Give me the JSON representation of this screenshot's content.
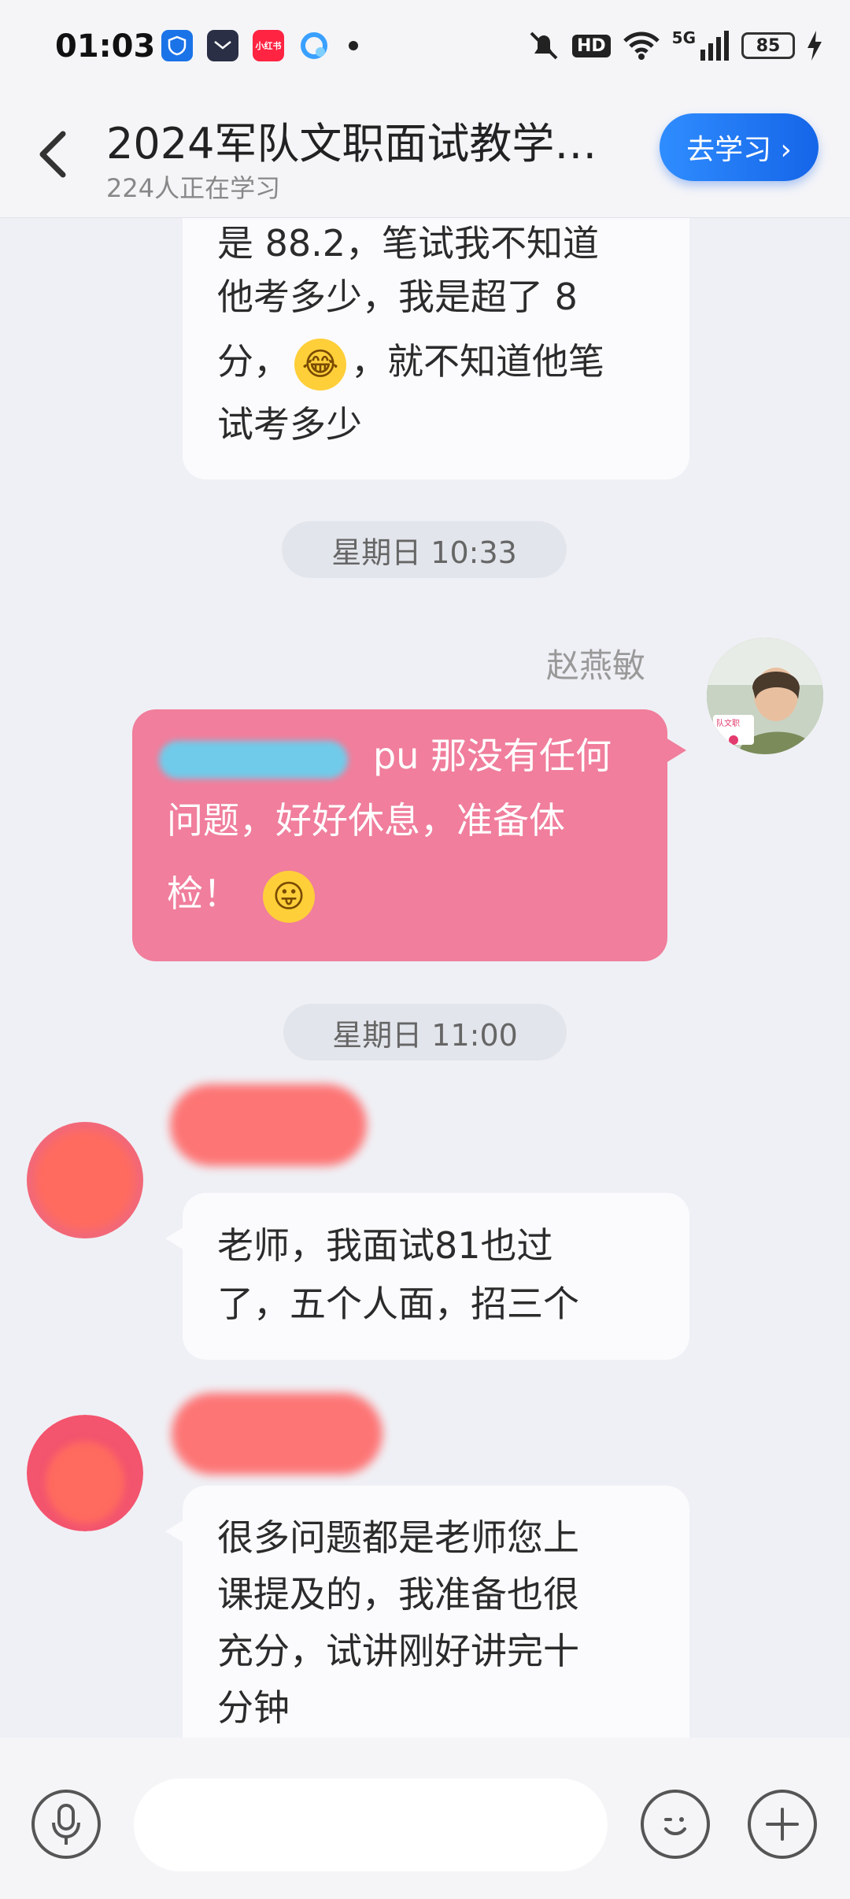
{
  "status_bar": {
    "time": "01:03",
    "app_icons": [
      "shield-app-icon",
      "calendar-app-icon",
      "xiaohongshu-app-icon",
      "cloud-app-icon"
    ],
    "xhs_label": "小红书",
    "hd_label": "HD",
    "network_label": "5G",
    "battery": "85"
  },
  "header": {
    "back_icon": "chevron-left-icon",
    "title": "2024军队文职面试教学…",
    "subtitle": "224人正在学习",
    "go_button": "去学习 ›"
  },
  "messages": {
    "m1": {
      "line1": "是 88.2，笔试我不知道",
      "line2": "他考多少，我是超了 8",
      "line3a": "分，",
      "line3b": "，就不知道他笔",
      "line4": "试考多少"
    },
    "time1": "星期日 10:33",
    "m2": {
      "sender": "赵燕敏",
      "line1": "pu 那没有任何",
      "line2": "问题，好好休息，准备体",
      "line3": "检！"
    },
    "time2": "星期日 11:00",
    "m3": {
      "line1": "老师，我面试81也过",
      "line2": "了，五个人面，招三个"
    },
    "m4": {
      "line1": "很多问题都是老师您上",
      "line2": "课提及的，我准备也很",
      "line3": "充分，试讲刚好讲完十",
      "line4": "分钟"
    }
  },
  "avatar_badge": "队文职",
  "input_bar": {
    "voice_icon": "microphone-icon",
    "emoji_icon": "emoji-icon",
    "plus_icon": "plus-icon"
  },
  "colors": {
    "accent": "#1b6ff0",
    "pink_bubble": "#f07e9c",
    "background": "#eff0f5"
  }
}
